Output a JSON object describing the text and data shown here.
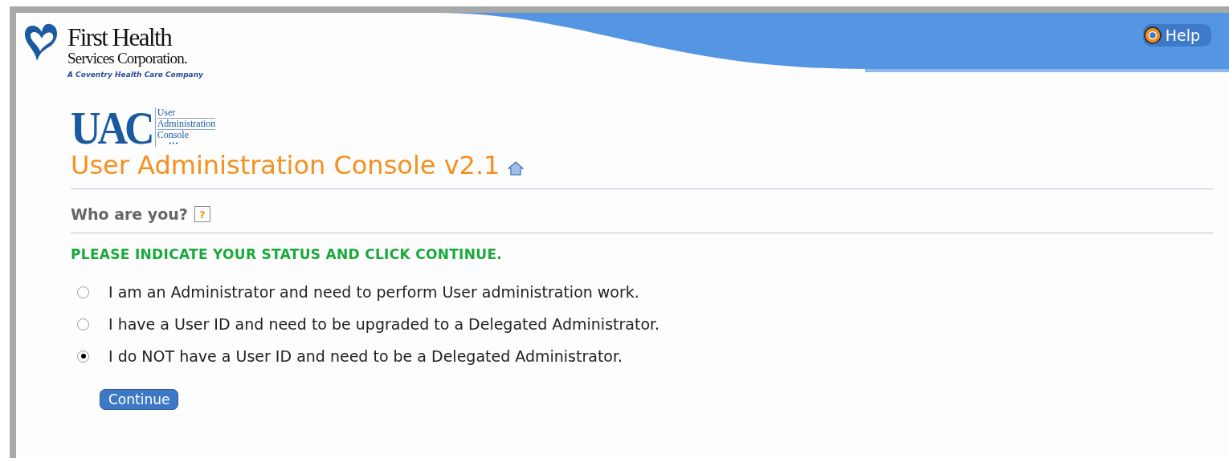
{
  "header": {
    "brand": {
      "name": "First Health",
      "subtitle": "Services Corporation.",
      "tagline": "A Coventry Health Care Company"
    },
    "product_logo": {
      "acronym": "UAC",
      "lines": [
        "User",
        "Administration",
        "Console"
      ],
      "dots": "•••"
    },
    "help_button": {
      "label": "Help"
    }
  },
  "page_title": "User Administration Console v2.1",
  "section_title": "Who are you?",
  "help_mark": "?",
  "instruction": "PLEASE INDICATE YOUR STATUS AND CLICK CONTINUE.",
  "options": [
    {
      "label": "I am an Administrator and need to perform User administration work.",
      "selected": false
    },
    {
      "label": "I have a User ID and need to be upgraded to a Delegated Administrator.",
      "selected": false
    },
    {
      "label": "I do NOT have a User ID and need to be a Delegated Administrator.",
      "selected": true
    }
  ],
  "buttons": [
    "Continue"
  ]
}
